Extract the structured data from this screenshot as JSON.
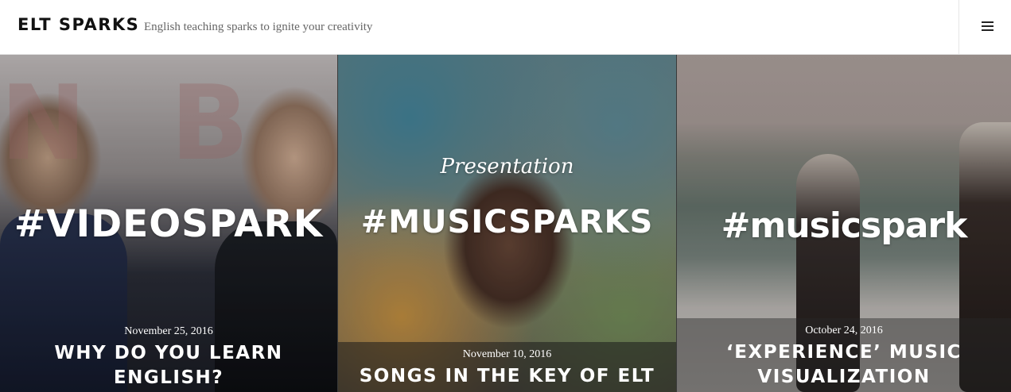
{
  "header": {
    "site_title": "ELT SPARKS",
    "tagline": "English teaching sparks to ignite your creativity",
    "menu_icon": "hamburger-menu-icon"
  },
  "posts": [
    {
      "image_text": "#VIDEOSPARK",
      "date": "November 25, 2016",
      "title": "WHY DO YOU LEARN ENGLISH?"
    },
    {
      "image_label": "Presentation",
      "image_text": "#MUSICSPARKS",
      "date": "November 10, 2016",
      "title": "SONGS IN THE KEY OF ELT"
    },
    {
      "image_text": "#musicspark",
      "date": "October 24, 2016",
      "title": "‘EXPERIENCE’ MUSIC VISUALIZATION"
    }
  ]
}
